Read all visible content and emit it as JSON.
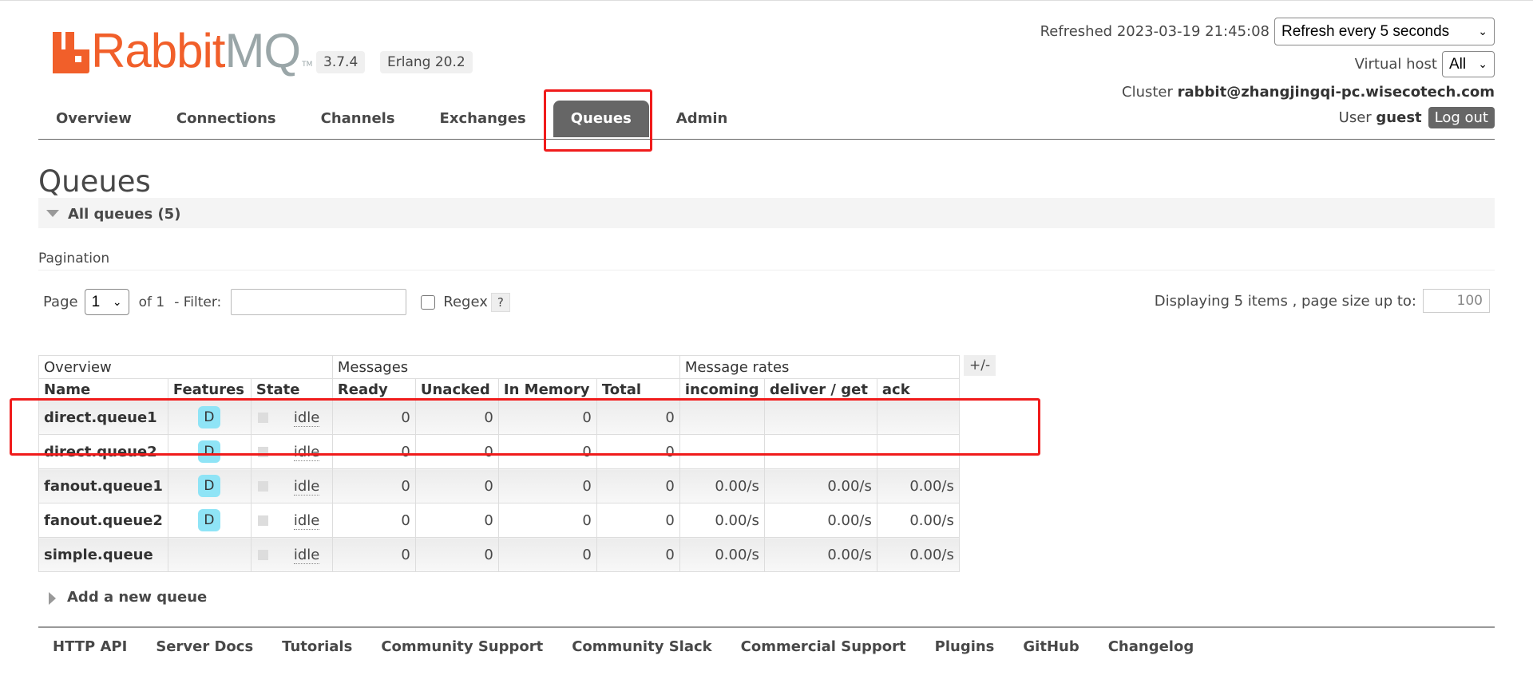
{
  "app": {
    "brand_orange": "Rabbit",
    "brand_grey": "MQ",
    "brand_tm": "TM",
    "version": "3.7.4",
    "erlang": "Erlang 20.2",
    "accent_color": "#f15f2a"
  },
  "header": {
    "refreshed_label": "Refreshed",
    "refreshed_time": "2023-03-19 21:45:08",
    "refresh_select": "Refresh every 5 seconds",
    "vhost_label": "Virtual host",
    "vhost_select": "All",
    "cluster_label": "Cluster",
    "cluster_name": "rabbit@zhangjingqi-pc.wisecotech.com",
    "user_label": "User",
    "user_name": "guest",
    "logout_label": "Log out"
  },
  "tabs": [
    "Overview",
    "Connections",
    "Channels",
    "Exchanges",
    "Queues",
    "Admin"
  ],
  "active_tab": "Queues",
  "page": {
    "title": "Queues",
    "section_label": "All queues (5)",
    "pagination_label": "Pagination",
    "page_label": "Page",
    "page_select": "1",
    "of_label": "of 1",
    "filter_label": "- Filter:",
    "filter_value": "",
    "regex_label": "Regex",
    "help_label": "?",
    "display_label": "Displaying 5 items , page size up to:",
    "page_size": "100"
  },
  "table": {
    "group_headers": [
      "Overview",
      "Messages",
      "Message rates"
    ],
    "columns": [
      "Name",
      "Features",
      "State",
      "Ready",
      "Unacked",
      "In Memory",
      "Total",
      "incoming",
      "deliver / get",
      "ack"
    ],
    "toggle_label": "+/-",
    "rows": [
      {
        "name": "direct.queue1",
        "feature": "D",
        "state": "idle",
        "ready": "0",
        "unacked": "0",
        "in_memory": "0",
        "total": "0",
        "incoming": "",
        "deliver_get": "",
        "ack": ""
      },
      {
        "name": "direct.queue2",
        "feature": "D",
        "state": "idle",
        "ready": "0",
        "unacked": "0",
        "in_memory": "0",
        "total": "0",
        "incoming": "",
        "deliver_get": "",
        "ack": ""
      },
      {
        "name": "fanout.queue1",
        "feature": "D",
        "state": "idle",
        "ready": "0",
        "unacked": "0",
        "in_memory": "0",
        "total": "0",
        "incoming": "0.00/s",
        "deliver_get": "0.00/s",
        "ack": "0.00/s"
      },
      {
        "name": "fanout.queue2",
        "feature": "D",
        "state": "idle",
        "ready": "0",
        "unacked": "0",
        "in_memory": "0",
        "total": "0",
        "incoming": "0.00/s",
        "deliver_get": "0.00/s",
        "ack": "0.00/s"
      },
      {
        "name": "simple.queue",
        "feature": "",
        "state": "idle",
        "ready": "0",
        "unacked": "0",
        "in_memory": "0",
        "total": "0",
        "incoming": "0.00/s",
        "deliver_get": "0.00/s",
        "ack": "0.00/s"
      }
    ]
  },
  "add_queue_label": "Add a new queue",
  "footer": [
    "HTTP API",
    "Server Docs",
    "Tutorials",
    "Community Support",
    "Community Slack",
    "Commercial Support",
    "Plugins",
    "GitHub",
    "Changelog"
  ]
}
